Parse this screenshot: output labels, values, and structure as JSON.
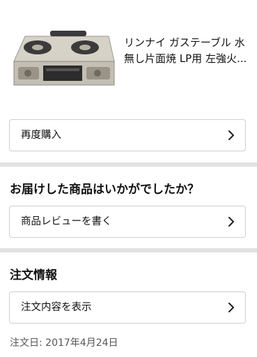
{
  "product": {
    "title": "リンナイ ガステーブル 水無し片面焼 LP用 左強火..."
  },
  "actions": {
    "rebuy_label": "再度購入"
  },
  "review": {
    "heading": "お届けした商品はいかがでしたか？",
    "write_review_label": "商品レビューを書く"
  },
  "order_info": {
    "heading": "注文情報",
    "show_details_label": "注文内容を表示",
    "order_date": "注文日: 2017年4月24日"
  },
  "icons": {
    "row_chevron": "chevron-right-icon"
  },
  "colors": {
    "divider": "#e2e2e2",
    "border": "#cfcfcf",
    "text": "#111111",
    "muted_text": "#555555"
  }
}
